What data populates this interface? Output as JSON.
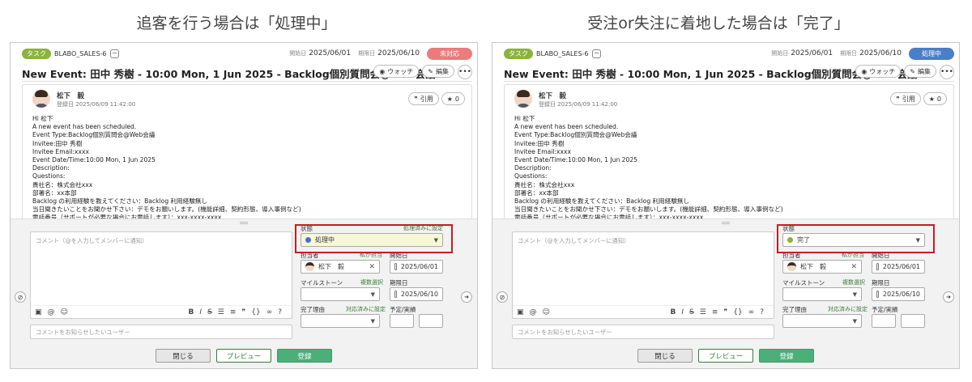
{
  "captions": {
    "left": "追客を行う場合は「処理中」",
    "right": "受注or失注に着地した場合は「完了」"
  },
  "panels": [
    {
      "id": "left",
      "tag": "タスク",
      "issue_key": "BLABO_SALES-6",
      "start_label": "開始日",
      "start_date": "2025/06/01",
      "due_label": "期限日",
      "due_date": "2025/06/10",
      "status": "未対応",
      "status_color": "#ec7b7b",
      "title": "New Event: 田中 秀樹 - 10:00 Mon, 1 Jun 2025 - Backlog個別質問会@Web会議",
      "watch_label": "ウォッチ",
      "edit_label": "編集",
      "more_label": "•••",
      "author": "松下　毅",
      "created": "登録日 2025/06/09 11:42:00",
      "quote_label": "引用",
      "star_count": "0",
      "body_lines": [
        "Hi 松下",
        "A new event has been scheduled.",
        "Event Type:Backlog個別質問会@Web会議",
        "Invitee:田中 秀樹",
        "Invitee Email:xxxx",
        "Event Date/Time:10:00 Mon, 1 Jun 2025",
        "Description:",
        "Questions:",
        "貴社名：株式会社xxx",
        "部署名：xx本部",
        "Backlog の利用経験を教えてください：Backlog 利用経験無し",
        "当日聞きたいことをお聞かせ下さい：デモをお願いします。(機能詳細、契約形態、導入事例など)",
        "電話番号（サポートが必要な場合にお電話します）：xxx-xxxx-xxxx"
      ],
      "comment_placeholder": "コメント（@を入力してメンバーに通知）",
      "notify_placeholder": "コメントをお知らせしたいユーザー",
      "state_label": "状態",
      "state_link": "処理済みに設定",
      "state_value": "処理中",
      "state_color": "#4a6fc8",
      "state_field_bg": "#f7f8d8",
      "assignee_label": "担当者",
      "assignee_link": "私が担当",
      "assignee_value": "松下　毅",
      "start_field_label": "開始日",
      "start_field_value": "2025/06/01",
      "milestone_label": "マイルストーン",
      "milestone_link": "複数選択",
      "due_field_label": "期限日",
      "due_field_value": "2025/06/10",
      "resolution_label": "完了理由",
      "resolution_link": "対応済みに設定",
      "estimate_label": "予定/実績",
      "close_btn": "閉じる",
      "preview_btn": "プレビュー",
      "save_btn": "登録"
    },
    {
      "id": "right",
      "tag": "タスク",
      "issue_key": "BLABO_SALES-6",
      "start_label": "開始日",
      "start_date": "2025/06/01",
      "due_label": "期限日",
      "due_date": "2025/06/10",
      "status": "処理中",
      "status_color": "#4a7ec8",
      "title": "New Event: 田中 秀樹 - 10:00 Mon, 1 Jun 2025 - Backlog個別質問会@Web会議",
      "watch_label": "ウォッチ",
      "edit_label": "編集",
      "more_label": "•••",
      "author": "松下　毅",
      "created": "登録日 2025/06/09 11:42:00",
      "quote_label": "引用",
      "star_count": "0",
      "body_lines": [
        "Hi 松下",
        "A new event has been scheduled.",
        "Event Type:Backlog個別質問会@Web会議",
        "Invitee:田中 秀樹",
        "Invitee Email:xxxx",
        "Event Date/Time:10:00 Mon, 1 Jun 2025",
        "Description:",
        "Questions:",
        "貴社名：株式会社xxx",
        "部署名：xx本部",
        "Backlog の利用経験を教えてください：Backlog 利用経験無し",
        "当日聞きたいことをお聞かせ下さい：デモをお願いします。(機能詳細、契約形態、導入事例など)",
        "電話番号（サポートが必要な場合にお電話します）：xxx-xxxx-xxxx"
      ],
      "comment_placeholder": "コメント（@を入力してメンバーに通知）",
      "notify_placeholder": "コメントをお知らせしたいユーザー",
      "state_label": "状態",
      "state_link": "",
      "state_value": "完了",
      "state_color": "#8bb33d",
      "state_field_bg": "#ffffff",
      "assignee_label": "担当者",
      "assignee_link": "私が担当",
      "assignee_value": "松下　毅",
      "start_field_label": "開始日",
      "start_field_value": "2025/06/01",
      "milestone_label": "マイルストーン",
      "milestone_link": "複数選択",
      "due_field_label": "期限日",
      "due_field_value": "2025/06/10",
      "resolution_label": "完了理由",
      "resolution_link": "対応済みに設定",
      "estimate_label": "予定/実績",
      "close_btn": "閉じる",
      "preview_btn": "プレビュー",
      "save_btn": "登録"
    }
  ]
}
